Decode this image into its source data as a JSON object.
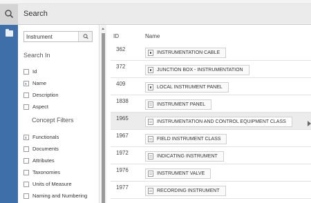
{
  "header": {
    "title": "Search",
    "search_icon": "search-icon"
  },
  "leftbar": {
    "icon": "folder-icon"
  },
  "filter": {
    "search_value": "Instrument",
    "search_icon": "search-icon",
    "search_in_heading": "Search In",
    "search_in": [
      {
        "label": "Id",
        "checked": false
      },
      {
        "label": "Name",
        "checked": true
      },
      {
        "label": "Description",
        "checked": false
      },
      {
        "label": "Aspect",
        "checked": false
      }
    ],
    "concept_filters_heading": "Concept Filters",
    "concept_filters": [
      {
        "label": "Functionals",
        "checked": true
      },
      {
        "label": "Documents",
        "checked": false
      },
      {
        "label": "Attributes",
        "checked": false
      },
      {
        "label": "Taxonomies",
        "checked": false
      },
      {
        "label": "Units of Measure",
        "checked": false
      },
      {
        "label": "Naming and Numbering",
        "checked": false
      }
    ]
  },
  "table": {
    "columns": {
      "id": "ID",
      "name": "Name"
    },
    "rows": [
      {
        "id": "362",
        "name": "INSTRUMENTATION CABLE",
        "icon": "dark"
      },
      {
        "id": "372",
        "name": "JUNCTION BOX - INSTRUMENTATION",
        "icon": "dark"
      },
      {
        "id": "409",
        "name": "LOCAL INSTRUMENT PANEL",
        "icon": "dark"
      },
      {
        "id": "1838",
        "name": "INSTRUMENT PANEL",
        "icon": "light"
      },
      {
        "id": "1965",
        "name": "INSTRUMENTATION AND CONTROL EQUIPMENT CLASS",
        "icon": "light",
        "highlighted": true
      },
      {
        "id": "1967",
        "name": "FIELD INSTRUMENT CLASS",
        "icon": "light"
      },
      {
        "id": "1972",
        "name": "INDICATING INSTRUMENT",
        "icon": "light"
      },
      {
        "id": "1976",
        "name": "INSTRUMENT VALVE",
        "icon": "light"
      },
      {
        "id": "1977",
        "name": "RECORDING INSTRUMENT",
        "icon": "light"
      }
    ]
  }
}
